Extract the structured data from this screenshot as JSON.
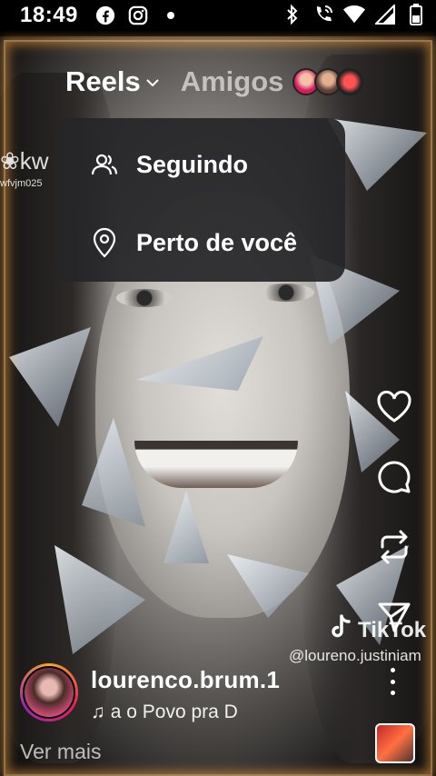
{
  "status_bar": {
    "time": "18:49",
    "left_icons": [
      "facebook-icon",
      "instagram-icon",
      "dot-icon"
    ],
    "right_icons": [
      "bluetooth-icon",
      "wifi-calling-icon",
      "wifi-icon",
      "cellular-signal-icon",
      "battery-icon"
    ]
  },
  "tabs": {
    "reels": "Reels",
    "amigos": "Amigos"
  },
  "dropdown": {
    "items": [
      {
        "label": "Seguindo",
        "icon": "people-icon"
      },
      {
        "label": "Perto de você",
        "icon": "location-pin-icon"
      }
    ]
  },
  "watermarks": {
    "kwai_text": "kw",
    "kwai_id": "wfvjm025",
    "tiktok_text": "TikTok",
    "tiktok_user": "@loureno.justiniam"
  },
  "actions": [
    "like-heart-icon",
    "comment-icon",
    "remix-icon",
    "share-send-icon"
  ],
  "post": {
    "username": "lourenco.brum.1",
    "music": "a o Povo pra D",
    "see_more": "Ver mais"
  },
  "colors": {
    "frame_glow": "#ffaa46",
    "dropdown_bg": "#262628"
  }
}
